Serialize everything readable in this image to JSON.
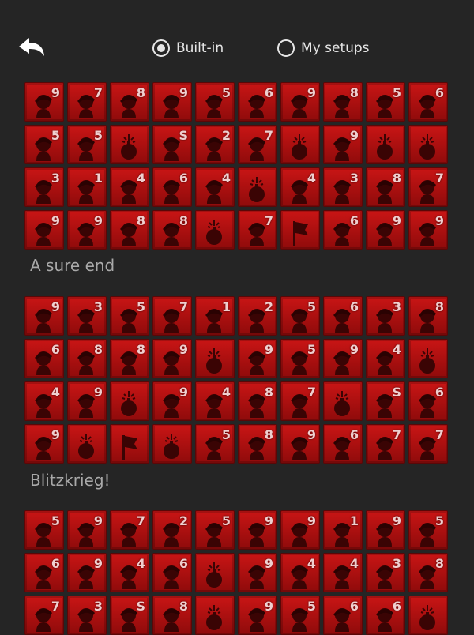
{
  "header": {
    "back_icon": "back-arrow-icon",
    "options": [
      {
        "label": "Built-in",
        "selected": true
      },
      {
        "label": "My setups",
        "selected": false
      }
    ]
  },
  "setups": [
    {
      "title": "",
      "rows": [
        [
          {
            "rank": "9",
            "icon": "soldier"
          },
          {
            "rank": "7",
            "icon": "soldier"
          },
          {
            "rank": "8",
            "icon": "soldier"
          },
          {
            "rank": "9",
            "icon": "soldier"
          },
          {
            "rank": "5",
            "icon": "soldier"
          },
          {
            "rank": "6",
            "icon": "soldier"
          },
          {
            "rank": "9",
            "icon": "soldier"
          },
          {
            "rank": "8",
            "icon": "soldier"
          },
          {
            "rank": "5",
            "icon": "soldier"
          },
          {
            "rank": "6",
            "icon": "soldier"
          }
        ],
        [
          {
            "rank": "5",
            "icon": "soldier"
          },
          {
            "rank": "5",
            "icon": "soldier"
          },
          {
            "rank": "",
            "icon": "bomb"
          },
          {
            "rank": "S",
            "icon": "soldier"
          },
          {
            "rank": "2",
            "icon": "soldier"
          },
          {
            "rank": "7",
            "icon": "soldier"
          },
          {
            "rank": "",
            "icon": "bomb"
          },
          {
            "rank": "9",
            "icon": "soldier"
          },
          {
            "rank": "",
            "icon": "bomb"
          },
          {
            "rank": "",
            "icon": "bomb"
          }
        ],
        [
          {
            "rank": "3",
            "icon": "soldier"
          },
          {
            "rank": "1",
            "icon": "soldier"
          },
          {
            "rank": "4",
            "icon": "soldier"
          },
          {
            "rank": "6",
            "icon": "soldier"
          },
          {
            "rank": "4",
            "icon": "soldier"
          },
          {
            "rank": "",
            "icon": "bomb"
          },
          {
            "rank": "4",
            "icon": "soldier"
          },
          {
            "rank": "3",
            "icon": "soldier"
          },
          {
            "rank": "8",
            "icon": "soldier"
          },
          {
            "rank": "7",
            "icon": "soldier"
          }
        ],
        [
          {
            "rank": "9",
            "icon": "soldier"
          },
          {
            "rank": "9",
            "icon": "soldier"
          },
          {
            "rank": "8",
            "icon": "soldier"
          },
          {
            "rank": "8",
            "icon": "soldier"
          },
          {
            "rank": "",
            "icon": "bomb"
          },
          {
            "rank": "7",
            "icon": "soldier"
          },
          {
            "rank": "",
            "icon": "flag"
          },
          {
            "rank": "6",
            "icon": "soldier"
          },
          {
            "rank": "9",
            "icon": "soldier"
          },
          {
            "rank": "9",
            "icon": "soldier"
          }
        ]
      ]
    },
    {
      "title": "A sure end",
      "rows": [
        [
          {
            "rank": "9",
            "icon": "soldier"
          },
          {
            "rank": "3",
            "icon": "soldier"
          },
          {
            "rank": "5",
            "icon": "soldier"
          },
          {
            "rank": "7",
            "icon": "soldier"
          },
          {
            "rank": "1",
            "icon": "soldier"
          },
          {
            "rank": "2",
            "icon": "soldier"
          },
          {
            "rank": "5",
            "icon": "soldier"
          },
          {
            "rank": "6",
            "icon": "soldier"
          },
          {
            "rank": "3",
            "icon": "soldier"
          },
          {
            "rank": "8",
            "icon": "soldier"
          }
        ],
        [
          {
            "rank": "6",
            "icon": "soldier"
          },
          {
            "rank": "8",
            "icon": "soldier"
          },
          {
            "rank": "8",
            "icon": "soldier"
          },
          {
            "rank": "9",
            "icon": "soldier"
          },
          {
            "rank": "",
            "icon": "bomb"
          },
          {
            "rank": "9",
            "icon": "soldier"
          },
          {
            "rank": "5",
            "icon": "soldier"
          },
          {
            "rank": "9",
            "icon": "soldier"
          },
          {
            "rank": "4",
            "icon": "soldier"
          },
          {
            "rank": "",
            "icon": "bomb"
          }
        ],
        [
          {
            "rank": "4",
            "icon": "soldier"
          },
          {
            "rank": "9",
            "icon": "soldier"
          },
          {
            "rank": "",
            "icon": "bomb"
          },
          {
            "rank": "9",
            "icon": "soldier"
          },
          {
            "rank": "4",
            "icon": "soldier"
          },
          {
            "rank": "8",
            "icon": "soldier"
          },
          {
            "rank": "7",
            "icon": "soldier"
          },
          {
            "rank": "",
            "icon": "bomb"
          },
          {
            "rank": "S",
            "icon": "soldier"
          },
          {
            "rank": "6",
            "icon": "soldier"
          }
        ],
        [
          {
            "rank": "9",
            "icon": "soldier"
          },
          {
            "rank": "",
            "icon": "bomb"
          },
          {
            "rank": "",
            "icon": "flag"
          },
          {
            "rank": "",
            "icon": "bomb"
          },
          {
            "rank": "5",
            "icon": "soldier"
          },
          {
            "rank": "8",
            "icon": "soldier"
          },
          {
            "rank": "9",
            "icon": "soldier"
          },
          {
            "rank": "6",
            "icon": "soldier"
          },
          {
            "rank": "7",
            "icon": "soldier"
          },
          {
            "rank": "7",
            "icon": "soldier"
          }
        ]
      ]
    },
    {
      "title": "Blitzkrieg!",
      "rows": [
        [
          {
            "rank": "5",
            "icon": "soldier"
          },
          {
            "rank": "9",
            "icon": "soldier"
          },
          {
            "rank": "7",
            "icon": "soldier"
          },
          {
            "rank": "2",
            "icon": "soldier"
          },
          {
            "rank": "5",
            "icon": "soldier"
          },
          {
            "rank": "9",
            "icon": "soldier"
          },
          {
            "rank": "9",
            "icon": "soldier"
          },
          {
            "rank": "1",
            "icon": "soldier"
          },
          {
            "rank": "9",
            "icon": "soldier"
          },
          {
            "rank": "5",
            "icon": "soldier"
          }
        ],
        [
          {
            "rank": "6",
            "icon": "soldier"
          },
          {
            "rank": "9",
            "icon": "soldier"
          },
          {
            "rank": "4",
            "icon": "soldier"
          },
          {
            "rank": "6",
            "icon": "soldier"
          },
          {
            "rank": "",
            "icon": "bomb"
          },
          {
            "rank": "9",
            "icon": "soldier"
          },
          {
            "rank": "4",
            "icon": "soldier"
          },
          {
            "rank": "4",
            "icon": "soldier"
          },
          {
            "rank": "3",
            "icon": "soldier"
          },
          {
            "rank": "8",
            "icon": "soldier"
          }
        ],
        [
          {
            "rank": "7",
            "icon": "soldier"
          },
          {
            "rank": "3",
            "icon": "soldier"
          },
          {
            "rank": "S",
            "icon": "soldier"
          },
          {
            "rank": "8",
            "icon": "soldier"
          },
          {
            "rank": "",
            "icon": "bomb"
          },
          {
            "rank": "9",
            "icon": "soldier"
          },
          {
            "rank": "5",
            "icon": "soldier"
          },
          {
            "rank": "6",
            "icon": "soldier"
          },
          {
            "rank": "6",
            "icon": "soldier"
          },
          {
            "rank": "",
            "icon": "bomb"
          }
        ]
      ]
    }
  ],
  "colors": {
    "tile": "#b00f0f",
    "background": "#252525",
    "label": "#a9a9a9"
  }
}
